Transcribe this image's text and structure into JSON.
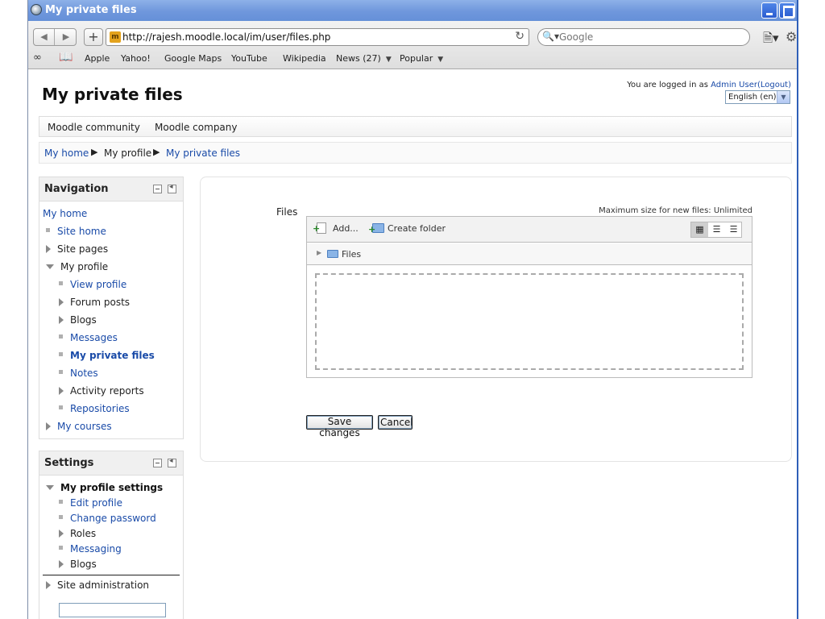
{
  "window": {
    "title": "My private files"
  },
  "browser": {
    "url": "http://rajesh.moodle.local/im/user/files.php",
    "search_placeholder": "Google",
    "bookmarks": [
      {
        "label": "Apple",
        "has_menu": false
      },
      {
        "label": "Yahoo!",
        "has_menu": false
      },
      {
        "label": "Google Maps",
        "has_menu": false
      },
      {
        "label": "YouTube",
        "has_menu": false
      },
      {
        "label": "Wikipedia",
        "has_menu": false
      },
      {
        "label": "News (27)",
        "has_menu": true
      },
      {
        "label": "Popular",
        "has_menu": true
      }
    ]
  },
  "page": {
    "heading": "My private files",
    "login": {
      "prefix": "You are logged in as",
      "user": "Admin User",
      "logout": "(Logout)"
    },
    "language": "English (en)",
    "custom_menu": [
      "Moodle community",
      "Moodle company"
    ],
    "breadcrumb": [
      "My home",
      "My profile",
      "My private files"
    ]
  },
  "navigation": {
    "title": "Navigation",
    "items": [
      {
        "label": "My home",
        "level": 0,
        "marker": "none",
        "style": "link"
      },
      {
        "label": "Site home",
        "level": 1,
        "marker": "bullet",
        "style": "link"
      },
      {
        "label": "Site pages",
        "level": 1,
        "marker": "collapsed",
        "style": "static"
      },
      {
        "label": "My profile",
        "level": 1,
        "marker": "expanded",
        "style": "static"
      },
      {
        "label": "View profile",
        "level": 2,
        "marker": "bullet",
        "style": "link"
      },
      {
        "label": "Forum posts",
        "level": 2,
        "marker": "collapsed",
        "style": "static"
      },
      {
        "label": "Blogs",
        "level": 2,
        "marker": "collapsed",
        "style": "static"
      },
      {
        "label": "Messages",
        "level": 2,
        "marker": "bullet",
        "style": "link"
      },
      {
        "label": "My private files",
        "level": 2,
        "marker": "bullet",
        "style": "active"
      },
      {
        "label": "Notes",
        "level": 2,
        "marker": "bullet",
        "style": "link"
      },
      {
        "label": "Activity reports",
        "level": 2,
        "marker": "collapsed",
        "style": "static"
      },
      {
        "label": "Repositories",
        "level": 2,
        "marker": "bullet",
        "style": "link"
      },
      {
        "label": "My courses",
        "level": 1,
        "marker": "collapsed",
        "style": "link"
      }
    ]
  },
  "settings": {
    "title": "Settings",
    "items": [
      {
        "label": "My profile settings",
        "level": 1,
        "marker": "expanded",
        "style": "bold"
      },
      {
        "label": "Edit profile",
        "level": 2,
        "marker": "bullet",
        "style": "link"
      },
      {
        "label": "Change password",
        "level": 2,
        "marker": "bullet",
        "style": "link"
      },
      {
        "label": "Roles",
        "level": 2,
        "marker": "collapsed",
        "style": "static"
      },
      {
        "label": "Messaging",
        "level": 2,
        "marker": "bullet",
        "style": "link"
      },
      {
        "label": "Blogs",
        "level": 2,
        "marker": "collapsed",
        "style": "static"
      },
      {
        "label": "Site administration",
        "level": 1,
        "marker": "collapsed",
        "style": "static"
      }
    ]
  },
  "files_form": {
    "label": "Files",
    "max_size": "Maximum size for new files: Unlimited",
    "add_label": "Add...",
    "create_folder_label": "Create folder",
    "path_label": "Files",
    "save_label": "Save changes",
    "cancel_label": "Cancel"
  },
  "colors": {
    "link": "#1a4ba8",
    "titlebar": "#6f97dc"
  },
  "icons": [
    "back-arrow-icon",
    "forward-arrow-icon",
    "reload-icon",
    "search-icon",
    "gear-icon",
    "folder-icon",
    "file-add-icon"
  ]
}
